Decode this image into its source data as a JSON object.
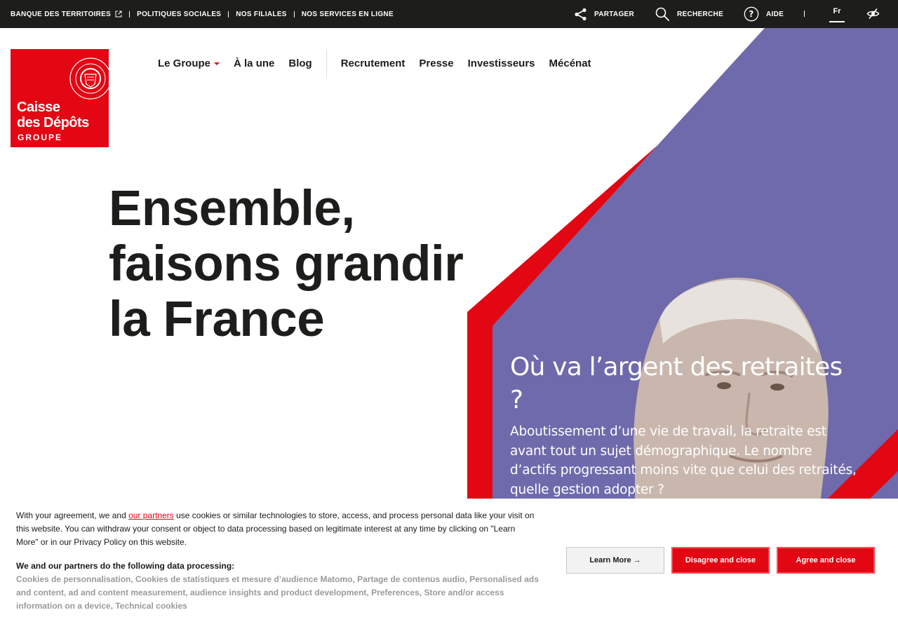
{
  "topbar": {
    "links": [
      {
        "label": "BANQUE DES TERRITOIRES"
      },
      {
        "label": "POLITIQUES SOCIALES"
      },
      {
        "label": "NOS FILIALES"
      },
      {
        "label": "NOS SERVICES EN LIGNE"
      }
    ],
    "share_label": "PARTAGER",
    "search_label": "RECHERCHE",
    "help_label": "AIDE",
    "language": "Fr"
  },
  "logo": {
    "line1": "Caisse",
    "line2": "des Dépôts",
    "line3": "GROUPE"
  },
  "nav": {
    "items": [
      {
        "label": "Le Groupe"
      },
      {
        "label": "À la une"
      },
      {
        "label": "Blog"
      },
      {
        "label": "Recrutement"
      },
      {
        "label": "Presse"
      },
      {
        "label": "Investisseurs"
      },
      {
        "label": "Mécénat"
      }
    ]
  },
  "hero": {
    "line1": "Ensemble,",
    "line2": "faisons grandir",
    "line3": "la France"
  },
  "feature": {
    "title": "Où va l’argent des retraites ?",
    "description": "Aboutissement d’une vie de travail, la retraite est avant tout un sujet démographique. Le nombre d’actifs progressant moins vite que celui des retraités, quelle gestion adopter ?"
  },
  "cookie": {
    "intro_before": "With your agreement, we and ",
    "partners_link": "our partners",
    "intro_after": " use cookies or similar technologies to store, access, and process personal data like your visit on this website. You can withdraw your consent or object to data processing based on legitimate interest at any time by clicking on \"Learn More\" or in our Privacy Policy on this website.",
    "processing_heading": "We and our partners do the following data processing:",
    "processing_list": "Cookies de personnalisation, Cookies de statistiques et mesure d’audience Matomo, Partage de contenus audio, Personalised ads and content, ad and content measurement, audience insights and product development, Preferences, Store and/or access information on a device, Technical cookies",
    "learn_more": "Learn More →",
    "disagree": "Disagree and close",
    "agree": "Agree and close"
  },
  "colors": {
    "brand_red": "#e30613",
    "topbar_bg": "#1d1d1b",
    "hero_purple": "#6e6aab"
  }
}
